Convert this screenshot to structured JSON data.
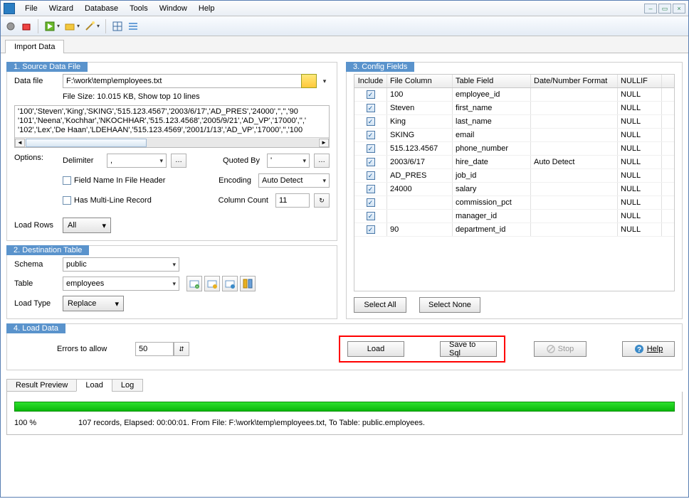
{
  "menu": {
    "file": "File",
    "wizard": "Wizard",
    "database": "Database",
    "tools": "Tools",
    "window": "Window",
    "help": "Help"
  },
  "tab": {
    "import": "Import Data"
  },
  "p1": {
    "title": "1. Source Data File",
    "datafile_label": "Data file",
    "datafile": "F:\\work\\temp\\employees.txt",
    "filesize_label": "File Size: 10.015 KB,   Show top 10 lines",
    "preview1": "'100','Steven','King','SKING','515.123.4567','2003/6/17','AD_PRES','24000','','','90",
    "preview2": "'101','Neena','Kochhar','NKOCHHAR','515.123.4568','2005/9/21','AD_VP','17000','','",
    "preview3": "'102','Lex','De Haan','LDEHAAN','515.123.4569','2001/1/13','AD_VP','17000','','100",
    "options_label": "Options:",
    "delimiter_label": "Delimiter",
    "delimiter": ",",
    "quotedby_label": "Quoted By",
    "quotedby": "'",
    "fieldname_label": "Field Name In File Header",
    "encoding_label": "Encoding",
    "encoding": "Auto Detect",
    "multiline_label": "Has Multi-Line Record",
    "colcount_label": "Column Count",
    "colcount": "11",
    "loadrows_label": "Load Rows",
    "loadrows": "All"
  },
  "p2": {
    "title": "2. Destination Table",
    "schema_label": "Schema",
    "schema": "public",
    "table_label": "Table",
    "table": "employees",
    "loadtype_label": "Load Type",
    "loadtype": "Replace"
  },
  "p3": {
    "title": "3. Config Fields",
    "h_include": "Include",
    "h_filecol": "File Column",
    "h_tablefield": "Table Field",
    "h_datefmt": "Date/Number Format",
    "h_nullif": "NULLIF",
    "rows": [
      {
        "fc": "100",
        "tf": "employee_id",
        "df": "",
        "nu": "NULL"
      },
      {
        "fc": "Steven",
        "tf": "first_name",
        "df": "",
        "nu": "NULL"
      },
      {
        "fc": "King",
        "tf": "last_name",
        "df": "",
        "nu": "NULL"
      },
      {
        "fc": "SKING",
        "tf": "email",
        "df": "",
        "nu": "NULL"
      },
      {
        "fc": "515.123.4567",
        "tf": "phone_number",
        "df": "",
        "nu": "NULL"
      },
      {
        "fc": "2003/6/17",
        "tf": "hire_date",
        "df": "Auto Detect",
        "nu": "NULL"
      },
      {
        "fc": "AD_PRES",
        "tf": "job_id",
        "df": "",
        "nu": "NULL"
      },
      {
        "fc": "24000",
        "tf": "salary",
        "df": "",
        "nu": "NULL"
      },
      {
        "fc": "",
        "tf": "commission_pct",
        "df": "",
        "nu": "NULL"
      },
      {
        "fc": "",
        "tf": "manager_id",
        "df": "",
        "nu": "NULL"
      },
      {
        "fc": "90",
        "tf": "department_id",
        "df": "",
        "nu": "NULL"
      }
    ],
    "select_all": "Select All",
    "select_none": "Select None"
  },
  "p4": {
    "title": "4. Load Data",
    "errors_label": "Errors to allow",
    "errors": "50",
    "load": "Load",
    "savesql": "Save to Sql",
    "stop": "Stop",
    "help": "Help"
  },
  "ltabs": {
    "preview": "Result Preview",
    "load": "Load",
    "log": "Log"
  },
  "status": {
    "pct": "100 %",
    "line": "107 records,    Elapsed: 00:00:01.    From File: F:\\work\\temp\\employees.txt,    To Table: public.employees."
  }
}
